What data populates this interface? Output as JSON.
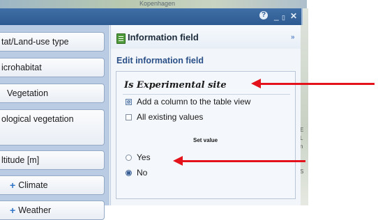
{
  "map": {
    "city_label": "Kopenhagen",
    "edge_texts": [
      "E",
      "L",
      "n",
      "S"
    ]
  },
  "window": {
    "help_icon": "help-icon",
    "minimize_glyph": "_",
    "maximize_glyph": "▯",
    "close_glyph": "✕",
    "help_glyph": "?"
  },
  "sidebar": {
    "items": [
      {
        "label": "tat/Land-use type",
        "icon": ""
      },
      {
        "label": "icrohabitat",
        "icon": ""
      },
      {
        "label": "Vegetation",
        "icon": ""
      },
      {
        "label": "ological vegetation",
        "icon": ""
      },
      {
        "label": "ltitude [m]",
        "icon": ""
      },
      {
        "label": "Climate",
        "icon": "plus-icon"
      },
      {
        "label": "Weather",
        "icon": "plus-icon"
      }
    ]
  },
  "panel": {
    "title": "Information field",
    "collapse_glyph": "»",
    "edit_title": "Edit information field",
    "field_name": "Is Experimental site",
    "options": [
      {
        "label": "Add a column to the table view",
        "checked": true
      },
      {
        "label": "All existing values",
        "checked": false
      }
    ],
    "set_value_label": "Set value",
    "radios": [
      {
        "label": "Yes",
        "selected": false
      },
      {
        "label": "No",
        "selected": true
      }
    ]
  },
  "annotations": {
    "arrow_color": "#e3121b"
  },
  "colors": {
    "titlebar": "#2d5a91",
    "accent_text": "#2a4f87",
    "panel_bg": "#f2f6fb"
  }
}
